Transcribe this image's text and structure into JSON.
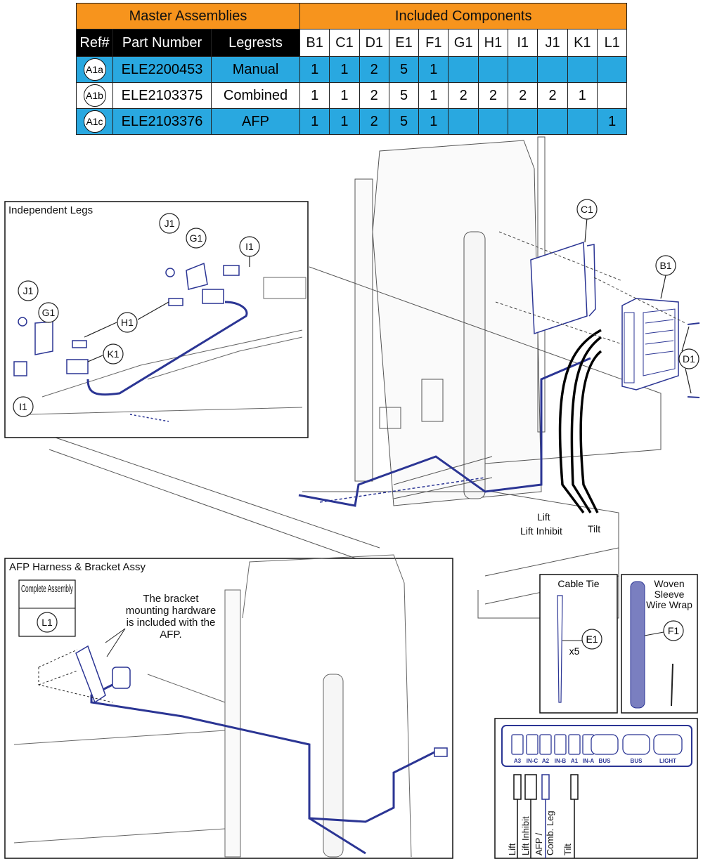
{
  "table": {
    "group_headers": {
      "master": "Master Assemblies",
      "included": "Included Components"
    },
    "columns": {
      "ref": "Ref#",
      "part_number": "Part Number",
      "legrests": "Legrests"
    },
    "component_codes": [
      "B1",
      "C1",
      "D1",
      "E1",
      "F1",
      "G1",
      "H1",
      "I1",
      "J1",
      "K1",
      "L1"
    ],
    "rows": [
      {
        "ref": "A1a",
        "part_number": "ELE2200453",
        "legrests": "Manual",
        "qty": [
          "1",
          "1",
          "2",
          "5",
          "1",
          "",
          "",
          "",
          "",
          "",
          ""
        ]
      },
      {
        "ref": "A1b",
        "part_number": "ELE2103375",
        "legrests": "Combined",
        "qty": [
          "1",
          "1",
          "2",
          "5",
          "1",
          "2",
          "2",
          "2",
          "2",
          "1",
          ""
        ]
      },
      {
        "ref": "A1c",
        "part_number": "ELE2103376",
        "legrests": "AFP",
        "qty": [
          "1",
          "1",
          "2",
          "5",
          "1",
          "",
          "",
          "",
          "",
          "",
          "1"
        ]
      }
    ],
    "colors": {
      "header": "#F7941D",
      "highlight": "#29A8E0",
      "dark": "#000000"
    }
  },
  "insets": {
    "independent_legs": "Independent Legs",
    "afp": "AFP Harness & Bracket Assy",
    "complete_assembly": "Complete Assembly",
    "complete_assembly_ref": "L1",
    "afp_note": [
      "The bracket",
      "mounting hardware",
      "is included with the",
      "AFP."
    ],
    "cable_tie": "Cable Tie",
    "cable_tie_ref": "E1",
    "cable_tie_qty": "x5",
    "woven_sleeve": [
      "Woven",
      "Sleeve",
      "Wire Wrap"
    ],
    "woven_sleeve_ref": "F1"
  },
  "callouts": {
    "c1": "C1",
    "b1": "B1",
    "d1": "D1",
    "j1a": "J1",
    "g1a": "G1",
    "i1a": "I1",
    "j1b": "J1",
    "g1b": "G1",
    "h1": "H1",
    "k1": "K1",
    "i1b": "I1"
  },
  "cable_labels": {
    "lift": "Lift",
    "lift_inhibit": "Lift Inhibit",
    "tilt": "Tilt"
  },
  "connector_panel": {
    "ports": [
      "A3",
      "IN-C",
      "A2",
      "IN-B",
      "A1",
      "IN-A",
      "BUS",
      "BUS",
      "LIGHT"
    ],
    "wires": [
      "Lift",
      "Lift Inhibit",
      "AFP /",
      "Comb. Leg",
      "Tilt"
    ],
    "wire_color": "#2B3594"
  }
}
